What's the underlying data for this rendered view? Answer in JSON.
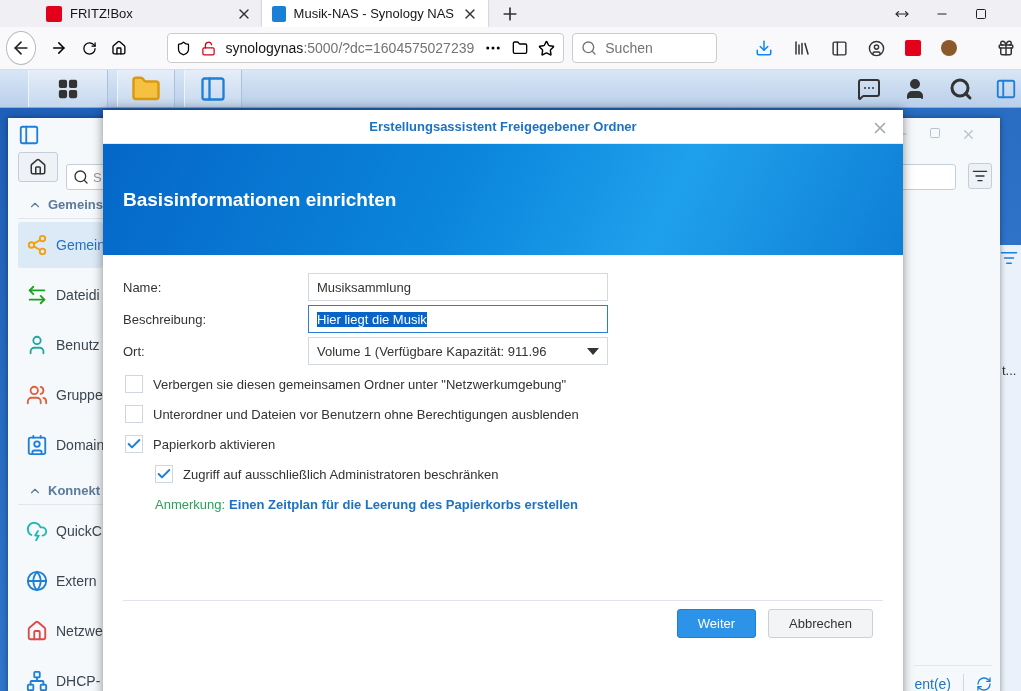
{
  "browser": {
    "tabs": [
      {
        "title": "FRITZ!Box",
        "selected": false
      },
      {
        "title": "Musik-NAS - Synology NAS",
        "selected": true
      }
    ],
    "address": {
      "host": "synologynas",
      "path": ":5000/?dc=1604575027239"
    },
    "search": {
      "placeholder": "Suchen"
    }
  },
  "control_panel": {
    "search_placeholder": "S",
    "sections": [
      {
        "title": "Gemeins",
        "expanded": true,
        "items": [
          {
            "label": "Gemein",
            "selected": true
          },
          {
            "label": "Dateidi",
            "selected": false
          },
          {
            "label": "Benutz",
            "selected": false
          },
          {
            "label": "Gruppe",
            "selected": false
          },
          {
            "label": "Domain",
            "selected": false
          }
        ]
      },
      {
        "title": "Konnekt",
        "expanded": true,
        "items": [
          {
            "label": "QuickC",
            "selected": false
          },
          {
            "label": "Extern",
            "selected": false
          },
          {
            "label": "Netzwe",
            "selected": false
          },
          {
            "label": "DHCP-",
            "selected": false
          }
        ]
      }
    ],
    "footer_text": "ent(e)"
  },
  "side_window": {
    "text": "t..."
  },
  "dialog": {
    "title": "Erstellungsassistent Freigegebener Ordner",
    "heading": "Basisinformationen einrichten",
    "fields": [
      {
        "label": "Name:",
        "kind": "text",
        "value": "Musiksammlung",
        "focused": false
      },
      {
        "label": "Beschreibung:",
        "kind": "text",
        "value": "Hier liegt die Musik",
        "focused": true
      },
      {
        "label": "Ort:",
        "kind": "select",
        "value": "Volume 1 (Verfügbare Kapazität: 911.96"
      }
    ],
    "options": [
      {
        "label": "Verbergen sie diesen gemeinsamen Ordner unter \"Netzwerkumgebung\"",
        "checked": false
      },
      {
        "label": "Unterordner und Dateien vor Benutzern ohne Berechtigungen ausblenden",
        "checked": false
      },
      {
        "label": "Papierkorb aktivieren",
        "checked": true,
        "children": [
          {
            "label": "Zugriff auf ausschließlich Administratoren beschränken",
            "checked": true
          }
        ]
      }
    ],
    "note": {
      "label": "Anmerkung:",
      "link": "Einen Zeitplan für die Leerung des Papierkorbs erstellen"
    },
    "buttons": [
      {
        "label": "Weiter",
        "kind": "primary"
      },
      {
        "label": "Abbrechen",
        "kind": "secondary"
      }
    ]
  }
}
